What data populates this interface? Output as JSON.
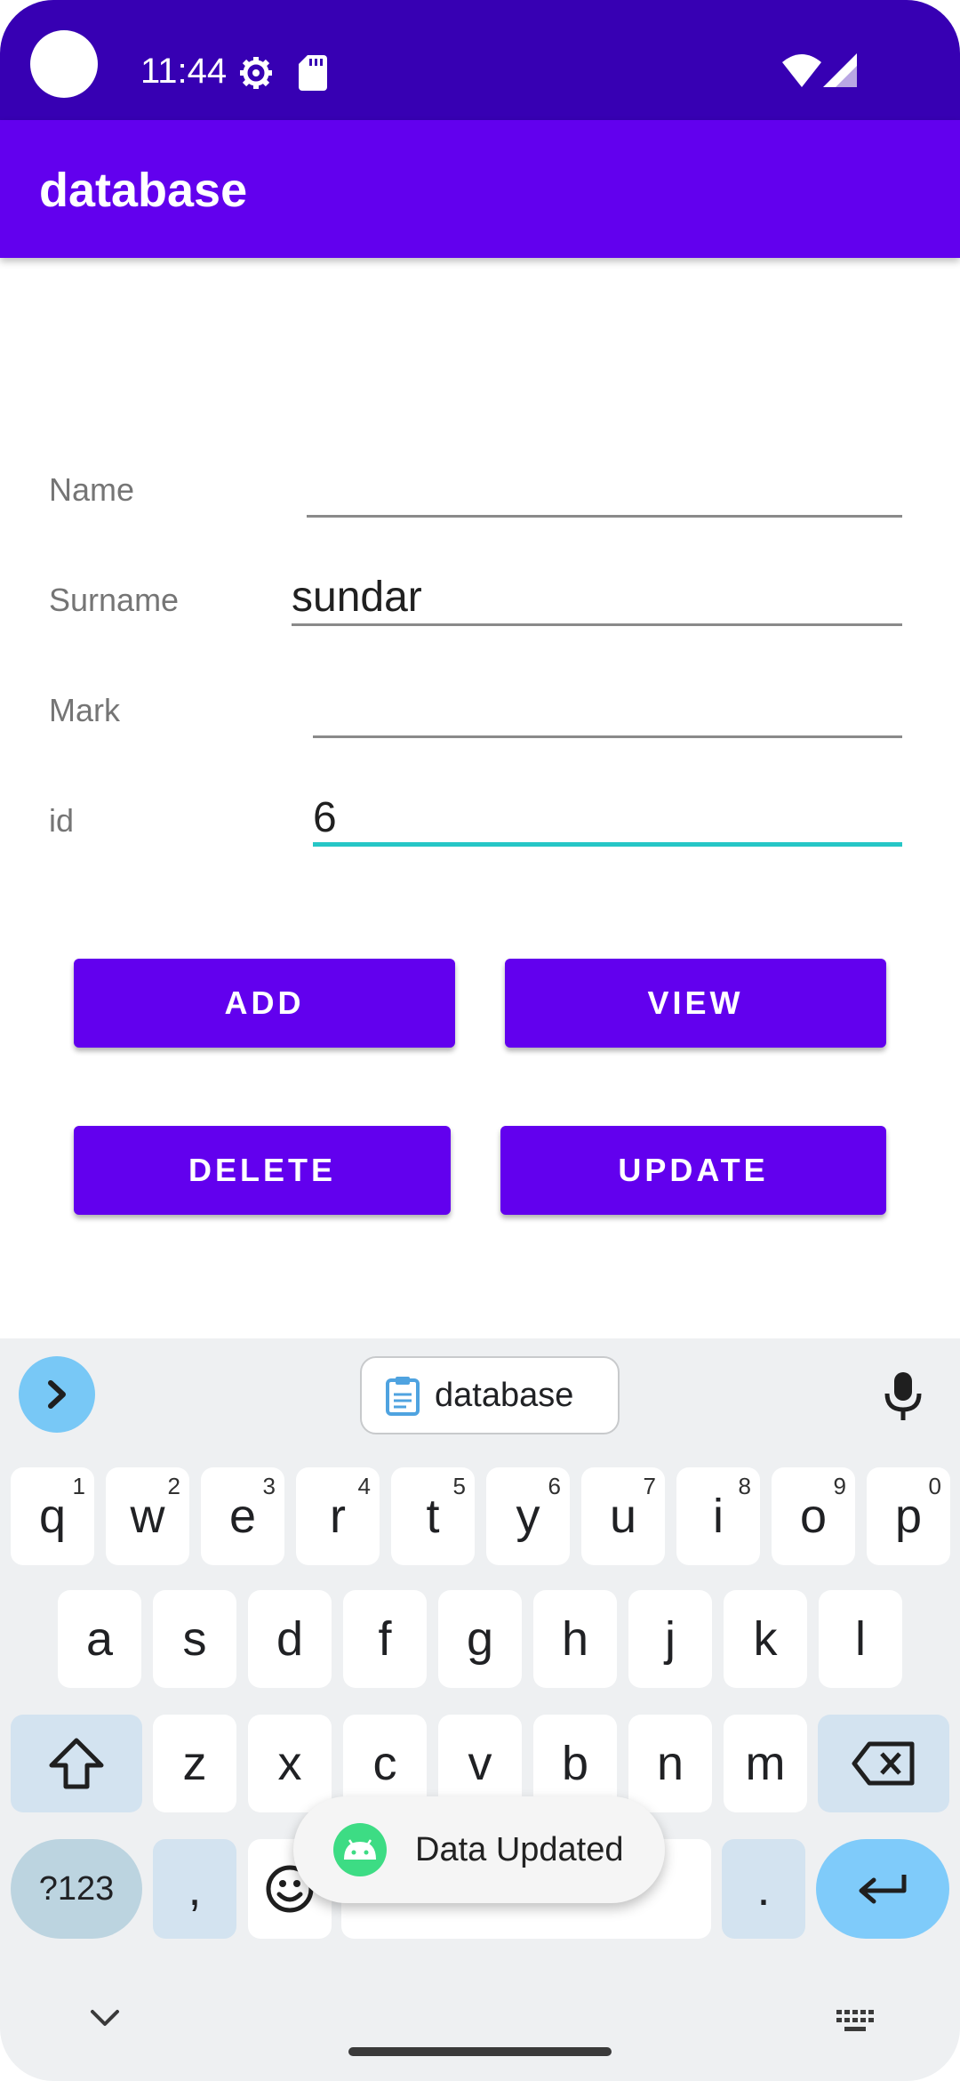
{
  "status_bar": {
    "time": "11:44",
    "icons": [
      "settings-icon",
      "sd-card-icon",
      "wifi-icon",
      "cell-signal-icon"
    ]
  },
  "app_bar": {
    "title": "database"
  },
  "form": {
    "fields": [
      {
        "label": "Name",
        "value": ""
      },
      {
        "label": "Surname",
        "value": "sundar"
      },
      {
        "label": "Mark",
        "value": ""
      },
      {
        "label": "id",
        "value": "6"
      }
    ],
    "focused_field": "id"
  },
  "buttons": {
    "add": "ADD",
    "view": "VIEW",
    "delete": "DELETE",
    "update": "UPDATE"
  },
  "keyboard": {
    "clipboard_suggestion": "database",
    "row1": [
      {
        "letter": "q",
        "hint": "1"
      },
      {
        "letter": "w",
        "hint": "2"
      },
      {
        "letter": "e",
        "hint": "3"
      },
      {
        "letter": "r",
        "hint": "4"
      },
      {
        "letter": "t",
        "hint": "5"
      },
      {
        "letter": "y",
        "hint": "6"
      },
      {
        "letter": "u",
        "hint": "7"
      },
      {
        "letter": "i",
        "hint": "8"
      },
      {
        "letter": "o",
        "hint": "9"
      },
      {
        "letter": "p",
        "hint": "0"
      }
    ],
    "row2": [
      "a",
      "s",
      "d",
      "f",
      "g",
      "h",
      "j",
      "k",
      "l"
    ],
    "row3": [
      "z",
      "x",
      "c",
      "v",
      "b",
      "n",
      "m"
    ],
    "symbols_key": "?123",
    "comma_key": ",",
    "period_key": "."
  },
  "toast": {
    "message": "Data Updated"
  },
  "colors": {
    "status_bar": "#3700b3",
    "primary": "#6200ee",
    "focus_underline": "#26c6c6"
  }
}
